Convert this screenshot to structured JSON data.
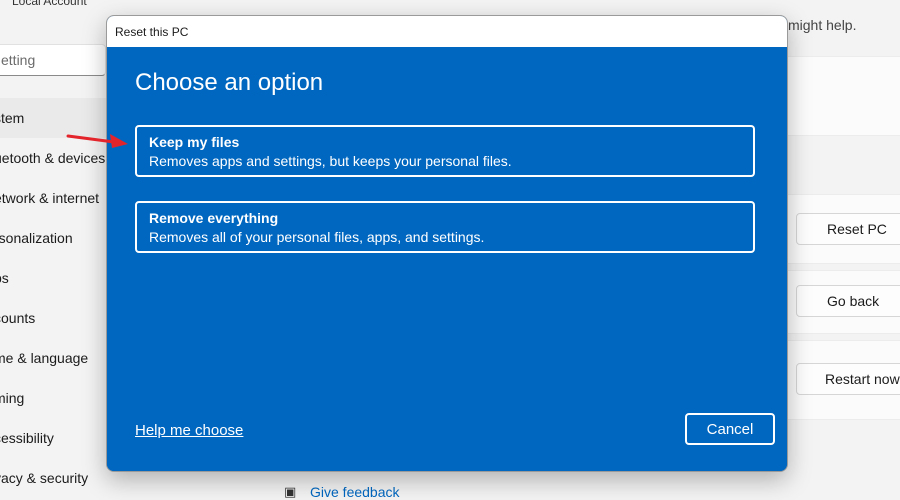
{
  "settings": {
    "account": "Local Account",
    "search_placeholder": "etting",
    "nav": [
      {
        "label": "stem",
        "active": true
      },
      {
        "label": "uetooth & devices"
      },
      {
        "label": "etwork & internet"
      },
      {
        "label": "rsonalization"
      },
      {
        "label": "ps"
      },
      {
        "label": "counts"
      },
      {
        "label": "me & language"
      },
      {
        "label": "ming"
      },
      {
        "label": "cessibility"
      },
      {
        "label": "vacy & security"
      }
    ],
    "help_text": "might help.",
    "buttons": {
      "reset_pc": "Reset PC",
      "go_back": "Go back",
      "restart_now": "Restart now"
    },
    "feedback": "Give feedback"
  },
  "dialog": {
    "title": "Reset this PC",
    "heading": "Choose an option",
    "options": [
      {
        "title": "Keep my files",
        "desc": "Removes apps and settings, but keeps your personal files."
      },
      {
        "title": "Remove everything",
        "desc": "Removes all of your personal files, apps, and settings."
      }
    ],
    "help_link": "Help me choose",
    "cancel": "Cancel"
  },
  "colors": {
    "accent_blue": "#0067c0",
    "annotation_arrow": "#e3242b"
  }
}
